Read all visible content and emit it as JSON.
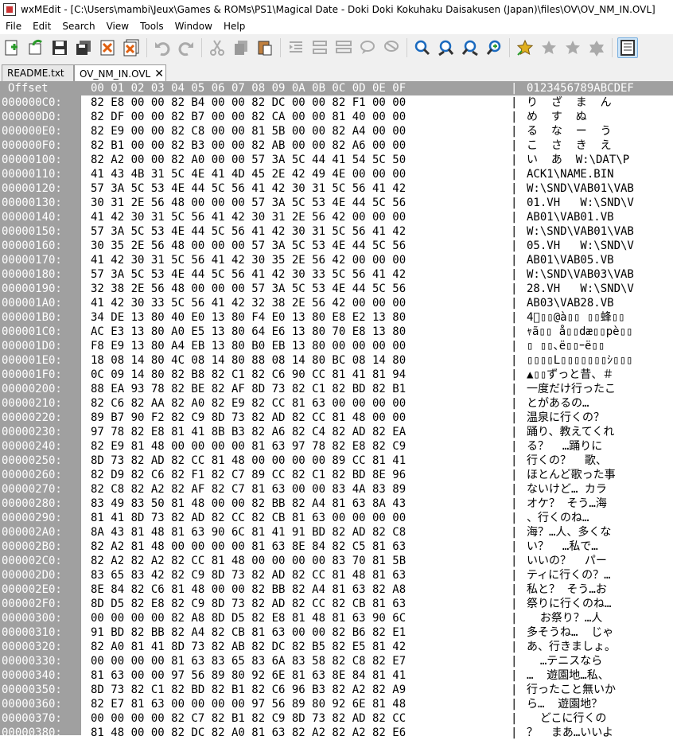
{
  "window": {
    "title": "wxMEdit - [C:\\Users\\mambi\\Jeux\\Games & ROMs\\PS1\\Magical Date - Doki Doki Kokuhaku Daisakusen (Japan)\\files\\OV\\OV_NM_IN.OVL]"
  },
  "menu": [
    "File",
    "Edit",
    "Search",
    "View",
    "Tools",
    "Window",
    "Help"
  ],
  "toolbar": {
    "icons": [
      "new-file-icon",
      "open-file-icon",
      "save-icon",
      "save-all-icon",
      "close-icon",
      "close-all-icon",
      "undo-icon",
      "redo-icon",
      "cut-icon",
      "copy-icon",
      "paste-icon",
      "indent-icon",
      "unindent-icon",
      "comment-icon",
      "uncomment-icon",
      "wordwrap-icon",
      "find-icon",
      "find-next-icon",
      "find-previous-icon",
      "replace-icon",
      "bookmark-icon",
      "bookmark-next-icon",
      "bookmark-prev-icon",
      "bookmark-clear-icon",
      "text-mode-icon"
    ]
  },
  "tabs": [
    {
      "label": "README.txt",
      "active": false
    },
    {
      "label": "OV_NM_IN.OVL",
      "active": true
    }
  ],
  "hex_header": {
    "offset_label": "Offset",
    "columns": "00 01 02 03 04 05 06 07 08 09 0A 0B 0C 0D 0E 0F",
    "separator": "|",
    "text_label": "0123456789ABCDEF"
  },
  "rows": [
    {
      "off": "000000C0:",
      "hex": "82 E8 00 00 82 B4 00 00 82 DC 00 00 82 F1 00 00",
      "txt": "り  ざ  ま  ん"
    },
    {
      "off": "000000D0:",
      "hex": "82 DF 00 00 82 B7 00 00 82 CA 00 00 81 40 00 00",
      "txt": "め  す  ぬ"
    },
    {
      "off": "000000E0:",
      "hex": "82 E9 00 00 82 C8 00 00 81 5B 00 00 82 A4 00 00",
      "txt": "る  な  ー  う"
    },
    {
      "off": "000000F0:",
      "hex": "82 B1 00 00 82 B3 00 00 82 AB 00 00 82 A6 00 00",
      "txt": "こ  さ  き  え"
    },
    {
      "off": "00000100:",
      "hex": "82 A2 00 00 82 A0 00 00 57 3A 5C 44 41 54 5C 50",
      "txt": "い  あ  W:\\DAT\\P"
    },
    {
      "off": "00000110:",
      "hex": "41 43 4B 31 5C 4E 41 4D 45 2E 42 49 4E 00 00 00",
      "txt": "ACK1\\NAME.BIN"
    },
    {
      "off": "00000120:",
      "hex": "57 3A 5C 53 4E 44 5C 56 41 42 30 31 5C 56 41 42",
      "txt": "W:\\SND\\VAB01\\VAB"
    },
    {
      "off": "00000130:",
      "hex": "30 31 2E 56 48 00 00 00 57 3A 5C 53 4E 44 5C 56",
      "txt": "01.VH   W:\\SND\\V"
    },
    {
      "off": "00000140:",
      "hex": "41 42 30 31 5C 56 41 42 30 31 2E 56 42 00 00 00",
      "txt": "AB01\\VAB01.VB"
    },
    {
      "off": "00000150:",
      "hex": "57 3A 5C 53 4E 44 5C 56 41 42 30 31 5C 56 41 42",
      "txt": "W:\\SND\\VAB01\\VAB"
    },
    {
      "off": "00000160:",
      "hex": "30 35 2E 56 48 00 00 00 57 3A 5C 53 4E 44 5C 56",
      "txt": "05.VH   W:\\SND\\V"
    },
    {
      "off": "00000170:",
      "hex": "41 42 30 31 5C 56 41 42 30 35 2E 56 42 00 00 00",
      "txt": "AB01\\VAB05.VB"
    },
    {
      "off": "00000180:",
      "hex": "57 3A 5C 53 4E 44 5C 56 41 42 30 33 5C 56 41 42",
      "txt": "W:\\SND\\VAB03\\VAB"
    },
    {
      "off": "00000190:",
      "hex": "32 38 2E 56 48 00 00 00 57 3A 5C 53 4E 44 5C 56",
      "txt": "28.VH   W:\\SND\\V"
    },
    {
      "off": "000001A0:",
      "hex": "41 42 30 33 5C 56 41 42 32 38 2E 56 42 00 00 00",
      "txt": "AB03\\VAB28.VB"
    },
    {
      "off": "000001B0:",
      "hex": "34 DE 13 80 40 E0 13 80 F4 E0 13 80 E8 E2 13 80",
      "txt": "4ﾞ▯▯@à▯▯ ▯▯蜂▯▯"
    },
    {
      "off": "000001C0:",
      "hex": "AC E3 13 80 A0 E5 13 80 64 E6 13 80 70 E8 13 80",
      "txt": "ｬã▯▯ å▯▯dæ▯▯pè▯▯"
    },
    {
      "off": "000001D0:",
      "hex": "F8 E9 13 80 A4 EB 13 80 B0 EB 13 80 00 00 00 00",
      "txt": "▯ ▯▯､ë▯▯ｰë▯▯"
    },
    {
      "off": "000001E0:",
      "hex": "18 08 14 80 4C 08 14 80 88 08 14 80 BC 08 14 80",
      "txt": "▯▯▯▯L▯▯▯▯▯▯▯ｼ▯▯▯"
    },
    {
      "off": "000001F0:",
      "hex": "0C 09 14 80 82 B8 82 C1 82 C6 90 CC 81 41 81 94",
      "txt": "▲▯▯ずっと昔、＃"
    },
    {
      "off": "00000200:",
      "hex": "88 EA 93 78 82 BE 82 AF 8D 73 82 C1 82 BD 82 B1",
      "txt": "一度だけ行ったこ"
    },
    {
      "off": "00000210:",
      "hex": "82 C6 82 AA 82 A0 82 E9 82 CC 81 63 00 00 00 00",
      "txt": "とがあるの…"
    },
    {
      "off": "00000220:",
      "hex": "89 B7 90 F2 82 C9 8D 73 82 AD 82 CC 81 48 00 00",
      "txt": "温泉に行くの？"
    },
    {
      "off": "00000230:",
      "hex": "97 78 82 E8 81 41 8B B3 82 A6 82 C4 82 AD 82 EA",
      "txt": "踊り、教えてくれ"
    },
    {
      "off": "00000240:",
      "hex": "82 E9 81 48 00 00 00 00 81 63 97 78 82 E8 82 C9",
      "txt": "る？  …踊りに"
    },
    {
      "off": "00000250:",
      "hex": "8D 73 82 AD 82 CC 81 48 00 00 00 00 89 CC 81 41",
      "txt": "行くの？  歌、"
    },
    {
      "off": "00000260:",
      "hex": "82 D9 82 C6 82 F1 82 C7 89 CC 82 C1 82 BD 8E 96",
      "txt": "ほとんど歌った事"
    },
    {
      "off": "00000270:",
      "hex": "82 C8 82 A2 82 AF 82 C7 81 63 00 00 83 4A 83 89",
      "txt": "ないけど… カラ"
    },
    {
      "off": "00000280:",
      "hex": "83 49 83 50 81 48 00 00 82 BB 82 A4 81 63 8A 43",
      "txt": "オケ？ そう…海"
    },
    {
      "off": "00000290:",
      "hex": "81 41 8D 73 82 AD 82 CC 82 CB 81 63 00 00 00 00",
      "txt": "、行くのね…"
    },
    {
      "off": "000002A0:",
      "hex": "8A 43 81 48 81 63 90 6C 81 41 91 BD 82 AD 82 C8",
      "txt": "海？…人、多くな"
    },
    {
      "off": "000002B0:",
      "hex": "82 A2 81 48 00 00 00 00 81 63 8E 84 82 C5 81 63",
      "txt": "い？  …私で…"
    },
    {
      "off": "000002C0:",
      "hex": "82 A2 82 A2 82 CC 81 48 00 00 00 00 83 70 81 5B",
      "txt": "いいの？  パー"
    },
    {
      "off": "000002D0:",
      "hex": "83 65 83 42 82 C9 8D 73 82 AD 82 CC 81 48 81 63",
      "txt": "ティに行くの？…"
    },
    {
      "off": "000002E0:",
      "hex": "8E 84 82 C6 81 48 00 00 82 BB 82 A4 81 63 82 A8",
      "txt": "私と？ そう…お"
    },
    {
      "off": "000002F0:",
      "hex": "8D D5 82 E8 82 C9 8D 73 82 AD 82 CC 82 CB 81 63",
      "txt": "祭りに行くのね…"
    },
    {
      "off": "00000300:",
      "hex": "00 00 00 00 82 A8 8D D5 82 E8 81 48 81 63 90 6C",
      "txt": "  お祭り？…人"
    },
    {
      "off": "00000310:",
      "hex": "91 BD 82 BB 82 A4 82 CB 81 63 00 00 82 B6 82 E1",
      "txt": "多そうね…  じゃ"
    },
    {
      "off": "00000320:",
      "hex": "82 A0 81 41 8D 73 82 AB 82 DC 82 B5 82 E5 81 42",
      "txt": "あ、行きましょ。"
    },
    {
      "off": "00000330:",
      "hex": "00 00 00 00 81 63 83 65 83 6A 83 58 82 C8 82 E7",
      "txt": "  …テニスなら"
    },
    {
      "off": "00000340:",
      "hex": "81 63 00 00 97 56 89 80 92 6E 81 63 8E 84 81 41",
      "txt": "…  遊園地…私、"
    },
    {
      "off": "00000350:",
      "hex": "8D 73 82 C1 82 BD 82 B1 82 C6 96 B3 82 A2 82 A9",
      "txt": "行ったこと無いか"
    },
    {
      "off": "00000360:",
      "hex": "82 E7 81 63 00 00 00 00 97 56 89 80 92 6E 81 48",
      "txt": "ら…  遊園地？"
    },
    {
      "off": "00000370:",
      "hex": "00 00 00 00 82 C7 82 B1 82 C9 8D 73 82 AD 82 CC",
      "txt": "  どこに行くの"
    },
    {
      "off": "00000380:",
      "hex": "81 48 00 00 82 DC 82 A0 81 63 82 A2 82 A2 82 E6",
      "txt": "？  まあ…いいよ"
    }
  ]
}
